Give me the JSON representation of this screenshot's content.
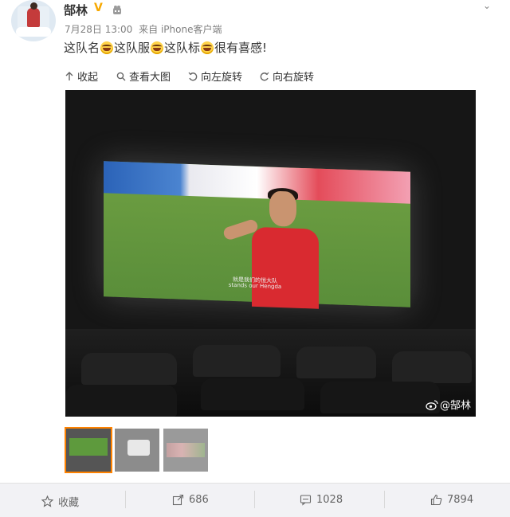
{
  "post": {
    "username": "郜林",
    "verified_badge": "V",
    "date": "7月28日 13:00",
    "source": "来自 iPhone客户端",
    "text_parts": [
      "这队名",
      "这队服",
      "这队标",
      "很有喜感!"
    ],
    "more": "⌄"
  },
  "toolbar": {
    "collapse": "收起",
    "view_large": "查看大图",
    "rotate_left": "向左旋转",
    "rotate_right": "向右旋转"
  },
  "photo": {
    "subtitle_cn": "就是我们的恒大队",
    "subtitle_en": "stands our Hengda",
    "watermark": "@郜林",
    "screen_text": "恒大"
  },
  "thumbnails": [
    {
      "label": "image-1",
      "selected": true
    },
    {
      "label": "image-2",
      "selected": false
    },
    {
      "label": "image-3",
      "selected": false
    }
  ],
  "actions": {
    "favorite": "收藏",
    "repost": "686",
    "comment": "1028",
    "like": "7894"
  },
  "colors": {
    "accent": "#ff8200",
    "verified": "#f7a800",
    "bar_bg": "#f2f2f5"
  }
}
